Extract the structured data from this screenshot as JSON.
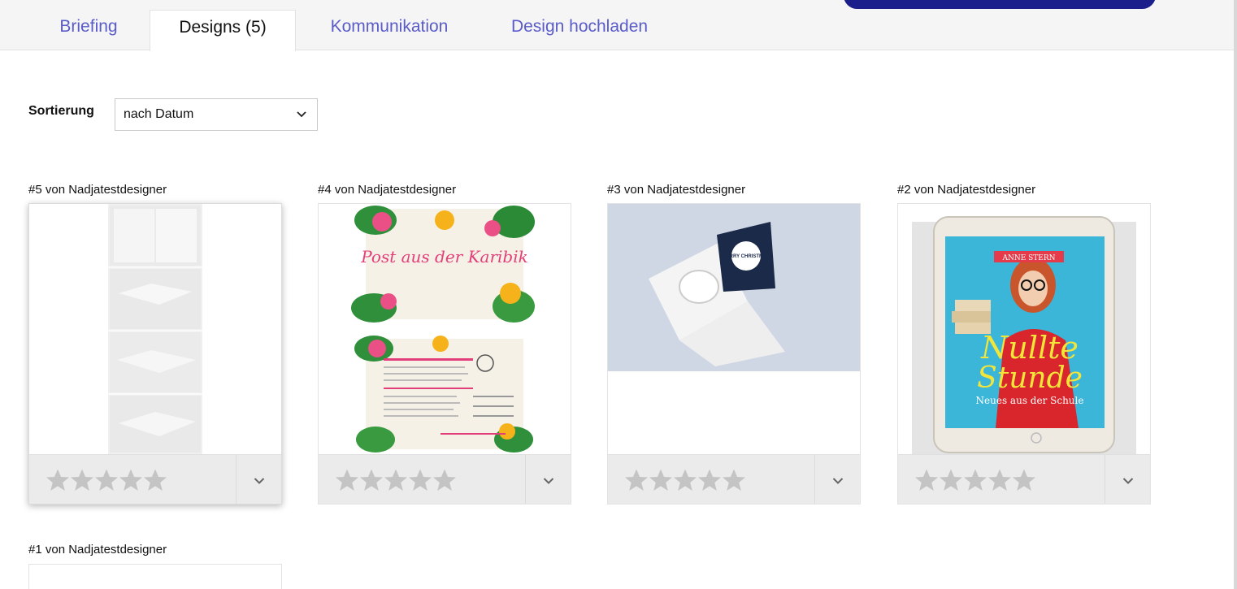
{
  "tabs": [
    {
      "label": "Briefing",
      "active": false
    },
    {
      "label": "Designs (5)",
      "active": true
    },
    {
      "label": "Kommunikation",
      "active": false
    },
    {
      "label": "Design hochladen",
      "active": false
    }
  ],
  "colors": {
    "accent": "#5a5cc9",
    "cta": "#1a1f8c",
    "star": "#c4c4c4"
  },
  "sort": {
    "label": "Sortierung",
    "value": "nach Datum"
  },
  "cards": [
    {
      "title": "#5 von Nadjatestdesigner",
      "rating": 0
    },
    {
      "title": "#4 von Nadjatestdesigner",
      "rating": 0,
      "front_text": "Post aus der Karibik"
    },
    {
      "title": "#3 von Nadjatestdesigner",
      "rating": 0,
      "card_text": "MERRY CHRISTMAS"
    },
    {
      "title": "#2 von Nadjatestdesigner",
      "rating": 0,
      "author": "ANNE STERN",
      "book_title_1": "Nullte",
      "book_title_2": "Stunde",
      "subtitle": "Neues aus der Schule"
    },
    {
      "title": "#1 von Nadjatestdesigner"
    }
  ]
}
